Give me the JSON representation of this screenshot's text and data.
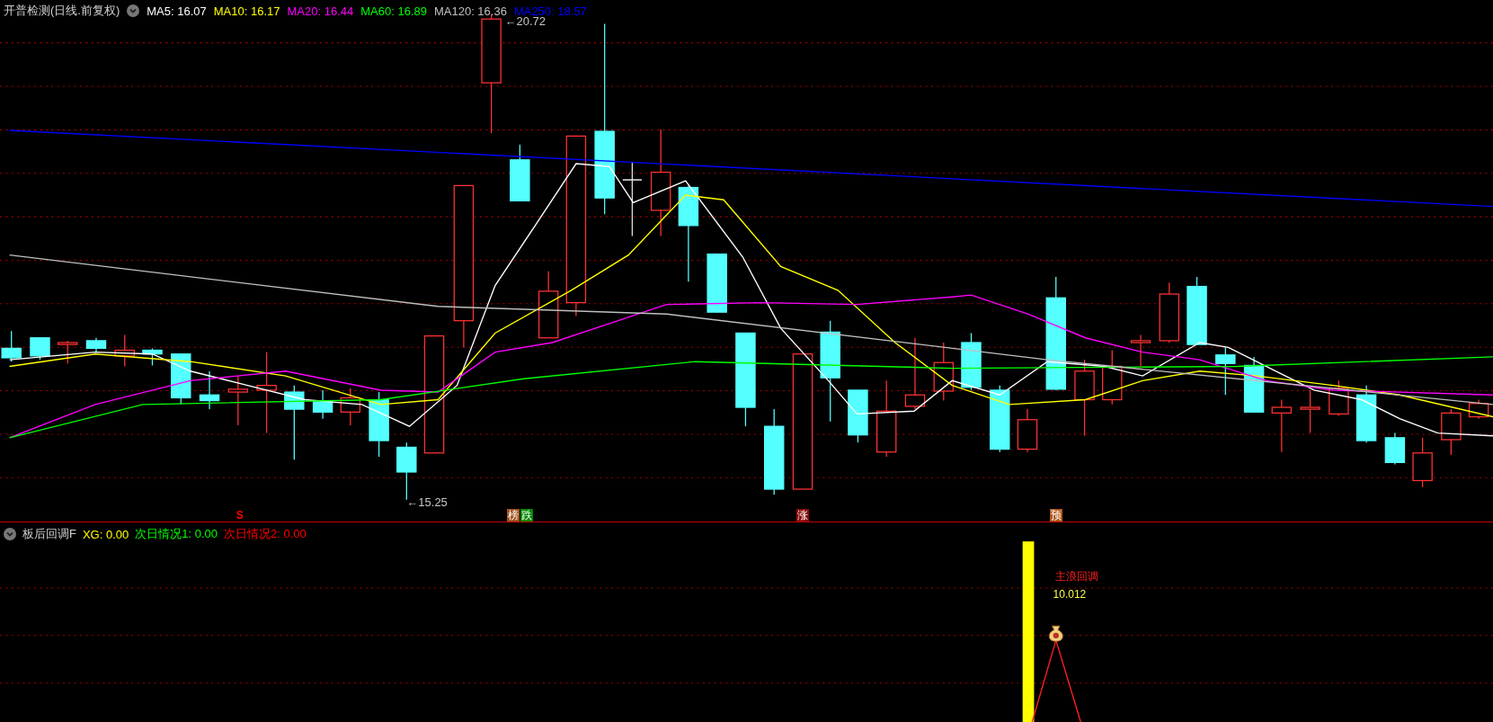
{
  "main_chart": {
    "title": "开普检测(日线.前复权)",
    "ma_legend": [
      {
        "text": "MA5: 16.07",
        "color": "#ffffff"
      },
      {
        "text": "MA10: 16.17",
        "color": "#ffff00"
      },
      {
        "text": "MA20: 16.44",
        "color": "#ff00ff"
      },
      {
        "text": "MA60: 16.89",
        "color": "#00ff00"
      },
      {
        "text": "MA120: 16.36",
        "color": "#c0c0c0"
      },
      {
        "text": "MA250: 18.57",
        "color": "#0000ff"
      }
    ],
    "price_labels": [
      "←20.72",
      "←15.25"
    ],
    "markers": [
      {
        "kind": "text",
        "text": "S",
        "color": "#ff0000"
      },
      {
        "kind": "tag",
        "text": "榜",
        "color": "#a0521e"
      },
      {
        "kind": "tag",
        "text": "跌",
        "color": "#008800"
      },
      {
        "kind": "tag",
        "text": "涨",
        "color": "#8b0a0a"
      },
      {
        "kind": "tag",
        "text": "预",
        "color": "#b0581c"
      }
    ]
  },
  "indicator_panel": {
    "title": "板后回调F",
    "legend": [
      {
        "text": "XG: 0.00",
        "color": "#ffff00"
      },
      {
        "text": "次日情况1: 0.00",
        "color": "#00ff00"
      },
      {
        "text": "次日情况2: 0.00",
        "color": "#ff0000"
      }
    ],
    "signal_title": "主浪回调",
    "signal_value": "10.012"
  }
}
